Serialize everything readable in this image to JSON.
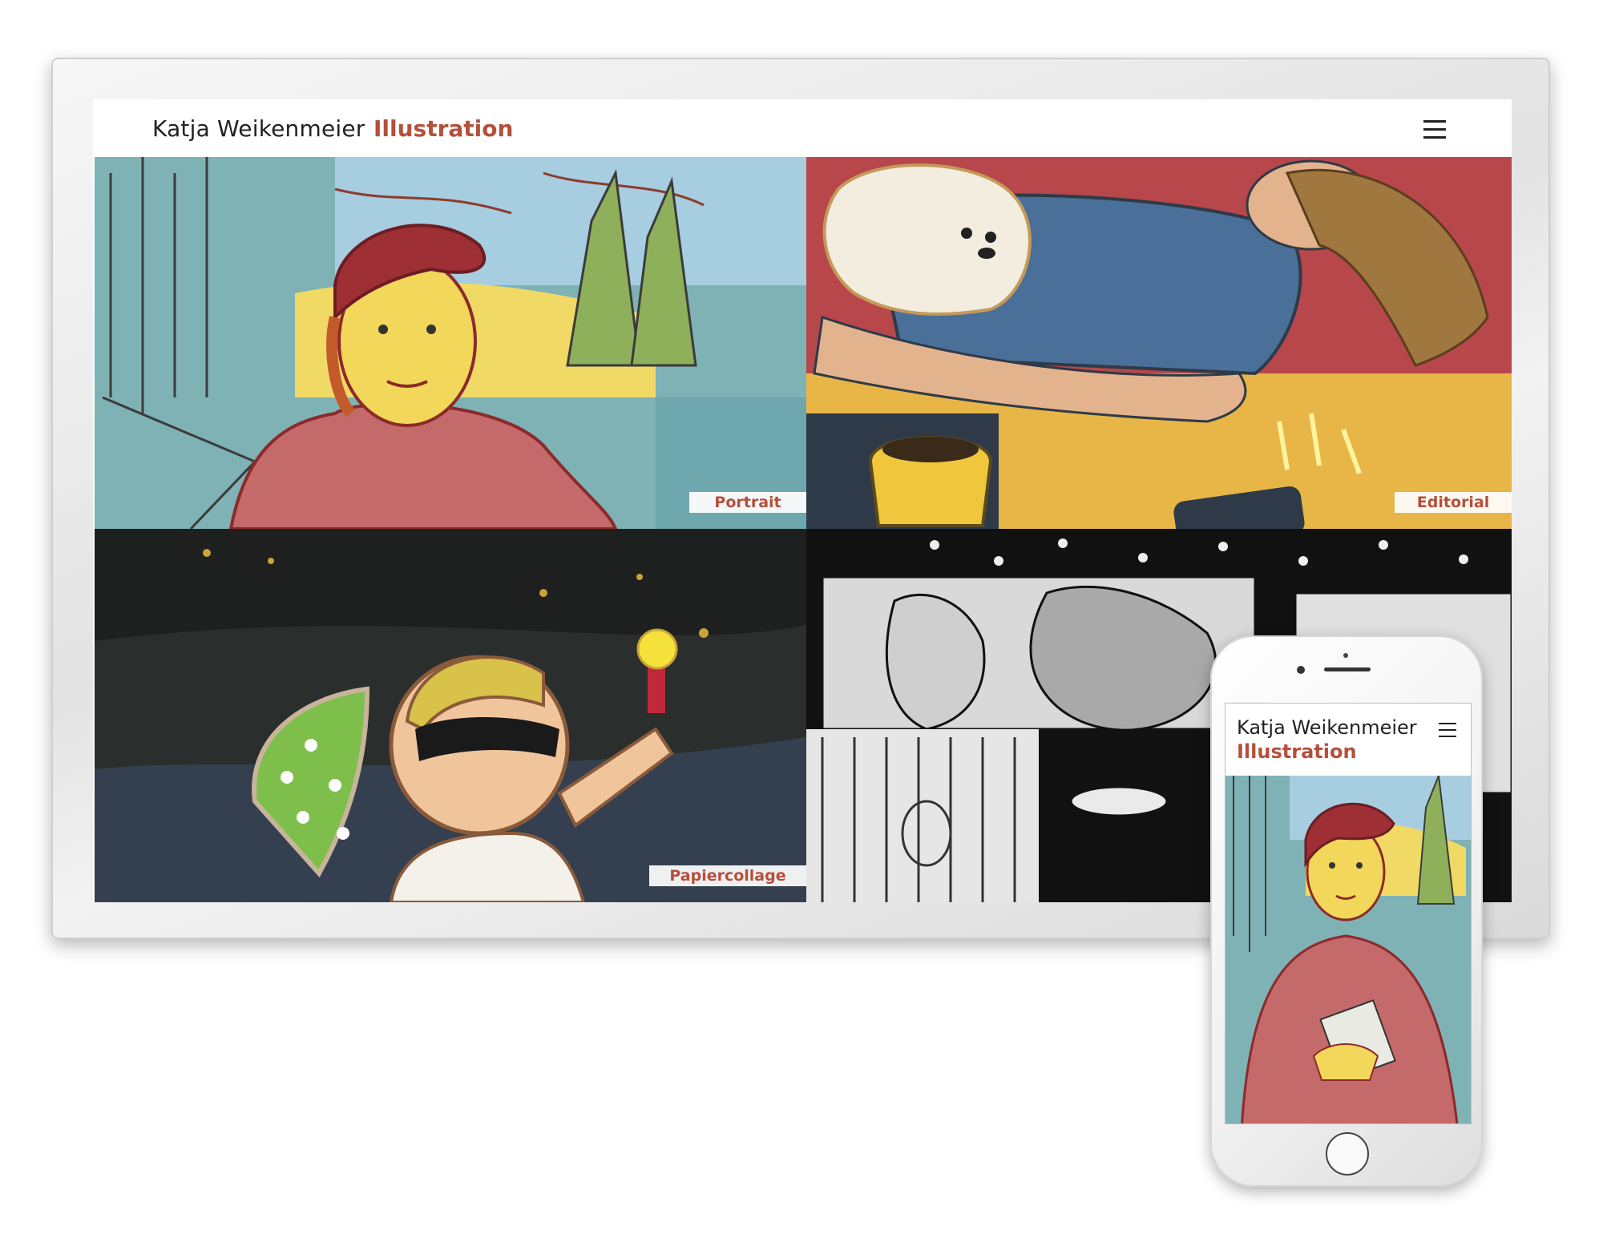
{
  "site": {
    "brand_name": "Katja Weikenmeier",
    "brand_sub": "Illustration",
    "menu_icon": "hamburger-icon",
    "accent_color": "#b4503a"
  },
  "gallery": {
    "tiles": [
      {
        "label": "Portrait"
      },
      {
        "label": "Editorial"
      },
      {
        "label": "Papiercollage"
      },
      {
        "label": ""
      }
    ]
  },
  "mobile": {
    "brand_name": "Katja Weikenmeier",
    "brand_sub": "Illustration",
    "menu_icon": "hamburger-icon"
  }
}
